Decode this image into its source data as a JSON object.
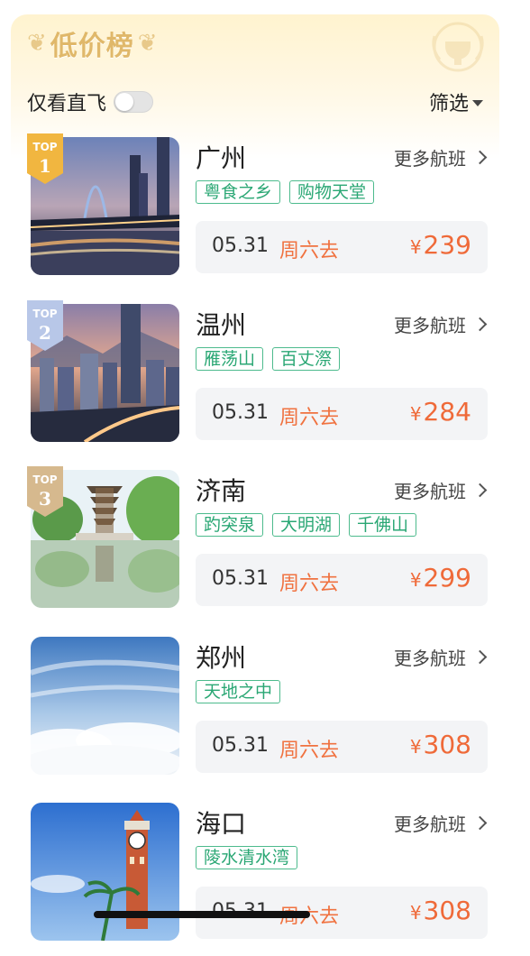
{
  "header": {
    "title": "低价榜",
    "direct_label": "仅看直飞",
    "direct_on": false,
    "filter_label": "筛选"
  },
  "colors": {
    "accent": "#ef6a39",
    "tag": "#2aa774",
    "gold": "#e0b86a"
  },
  "rank_badge_text": "TOP",
  "items": [
    {
      "rank": "1",
      "city": "广州",
      "more": "更多航班",
      "tags": [
        "粤食之乡",
        "购物天堂"
      ],
      "date": "05.31",
      "day": "周六去",
      "currency": "¥",
      "price": "239",
      "image": "guangzhou-night-skyline"
    },
    {
      "rank": "2",
      "city": "温州",
      "more": "更多航班",
      "tags": [
        "雁荡山",
        "百丈漈"
      ],
      "date": "05.31",
      "day": "周六去",
      "currency": "¥",
      "price": "284",
      "image": "wenzhou-city-skyline"
    },
    {
      "rank": "3",
      "city": "济南",
      "more": "更多航班",
      "tags": [
        "趵突泉",
        "大明湖",
        "千佛山"
      ],
      "date": "05.31",
      "day": "周六去",
      "currency": "¥",
      "price": "299",
      "image": "jinan-pagoda-lake"
    },
    {
      "rank": "",
      "city": "郑州",
      "more": "更多航班",
      "tags": [
        "天地之中"
      ],
      "date": "05.31",
      "day": "周六去",
      "currency": "¥",
      "price": "308",
      "image": "zhengzhou-sky-clouds"
    },
    {
      "rank": "",
      "city": "海口",
      "more": "更多航班",
      "tags": [
        "陵水清水湾"
      ],
      "date": "05.31",
      "day": "周六去",
      "currency": "¥",
      "price": "308",
      "image": "haikou-clock-tower"
    }
  ]
}
